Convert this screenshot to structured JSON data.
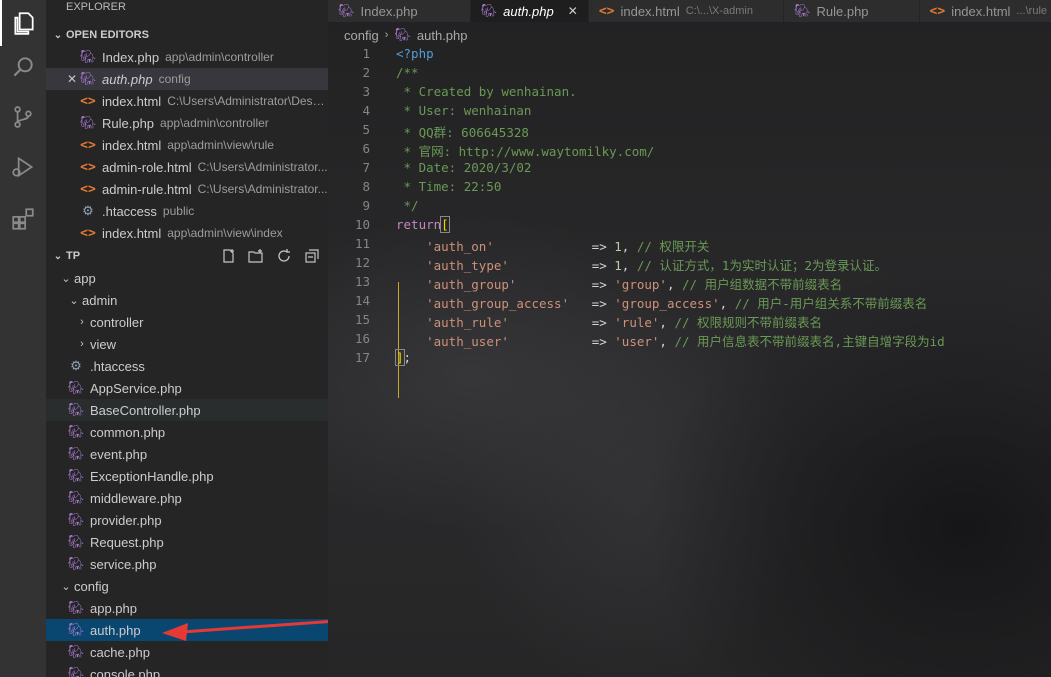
{
  "explorer": {
    "title": "EXPLORER",
    "open_editors_label": "OPEN EDITORS",
    "open_editors": [
      {
        "name": "Index.php",
        "desc": "app\\admin\\controller",
        "icon": "php-elephant-icon"
      },
      {
        "name": "auth.php",
        "desc": "config",
        "icon": "php-elephant-icon"
      },
      {
        "name": "index.html",
        "desc": "C:\\Users\\Administrator\\Desk...",
        "icon": "html-icon"
      },
      {
        "name": "Rule.php",
        "desc": "app\\admin\\controller",
        "icon": "php-elephant-icon"
      },
      {
        "name": "index.html",
        "desc": "app\\admin\\view\\rule",
        "icon": "html-icon"
      },
      {
        "name": "admin-role.html",
        "desc": "C:\\Users\\Administrator...",
        "icon": "html-icon"
      },
      {
        "name": "admin-rule.html",
        "desc": "C:\\Users\\Administrator...",
        "icon": "html-icon"
      },
      {
        "name": ".htaccess",
        "desc": "public",
        "icon": "gear-icon"
      },
      {
        "name": "index.html",
        "desc": "app\\admin\\view\\index",
        "icon": "html-icon"
      }
    ],
    "project_label": "TP",
    "tree": {
      "app": "app",
      "admin": "admin",
      "controller": "controller",
      "view": "view",
      "files_app": [
        ".htaccess",
        "AppService.php",
        "BaseController.php",
        "common.php",
        "event.php",
        "ExceptionHandle.php",
        "middleware.php",
        "provider.php",
        "Request.php",
        "service.php"
      ],
      "config": "config",
      "files_config": [
        "app.php",
        "auth.php",
        "cache.php",
        "console.php"
      ]
    }
  },
  "tabs": [
    {
      "label": "Index.php",
      "desc": ""
    },
    {
      "label": "auth.php",
      "desc": "",
      "active": true
    },
    {
      "label": "index.html",
      "desc": "C:\\...\\X-admin"
    },
    {
      "label": "Rule.php",
      "desc": ""
    },
    {
      "label": "index.html",
      "desc": "...\\rule"
    }
  ],
  "breadcrumb": {
    "folder": "config",
    "file": "auth.php"
  },
  "code": {
    "line_numbers": [
      "1",
      "2",
      "3",
      "4",
      "5",
      "6",
      "7",
      "8",
      "9",
      "10",
      "11",
      "12",
      "13",
      "14",
      "15",
      "16",
      "17"
    ],
    "l1": "<?php",
    "l2": "/**",
    "l3": " * Created by wenhainan.",
    "l4": " * User: wenhainan",
    "l5": " * QQ群: 606645328",
    "l6": " * 官网: http://www.waytomilky.com/",
    "l7": " * Date: 2020/3/02",
    "l8": " * Time: 22:50",
    "l9": " */",
    "l10_kw": "return",
    "l10_br": "[",
    "rows": [
      {
        "key": "'auth_on'",
        "pad": "            ",
        "val": "1",
        "comment": "// 权限开关",
        "num": true
      },
      {
        "key": "'auth_type'",
        "pad": "          ",
        "val": "1",
        "comment": "// 认证方式，1为实时认证；2为登录认证。",
        "num": true
      },
      {
        "key": "'auth_group'",
        "pad": "         ",
        "val": "'group'",
        "comment": "// 用户组数据不带前缀表名",
        "num": false
      },
      {
        "key": "'auth_group_access'",
        "pad": "  ",
        "val": "'group_access'",
        "comment": "// 用户-用户组关系不带前缀表名",
        "num": false
      },
      {
        "key": "'auth_rule'",
        "pad": "          ",
        "val": "'rule'",
        "comment": "// 权限规则不带前缀表名",
        "num": false
      },
      {
        "key": "'auth_user'",
        "pad": "          ",
        "val": "'user'",
        "comment": "// 用户信息表不带前缀表名,主键自增字段为id",
        "num": false
      }
    ],
    "l17_br": "]",
    "l17_end": ";",
    "arrow": "=>",
    "comma": ","
  }
}
